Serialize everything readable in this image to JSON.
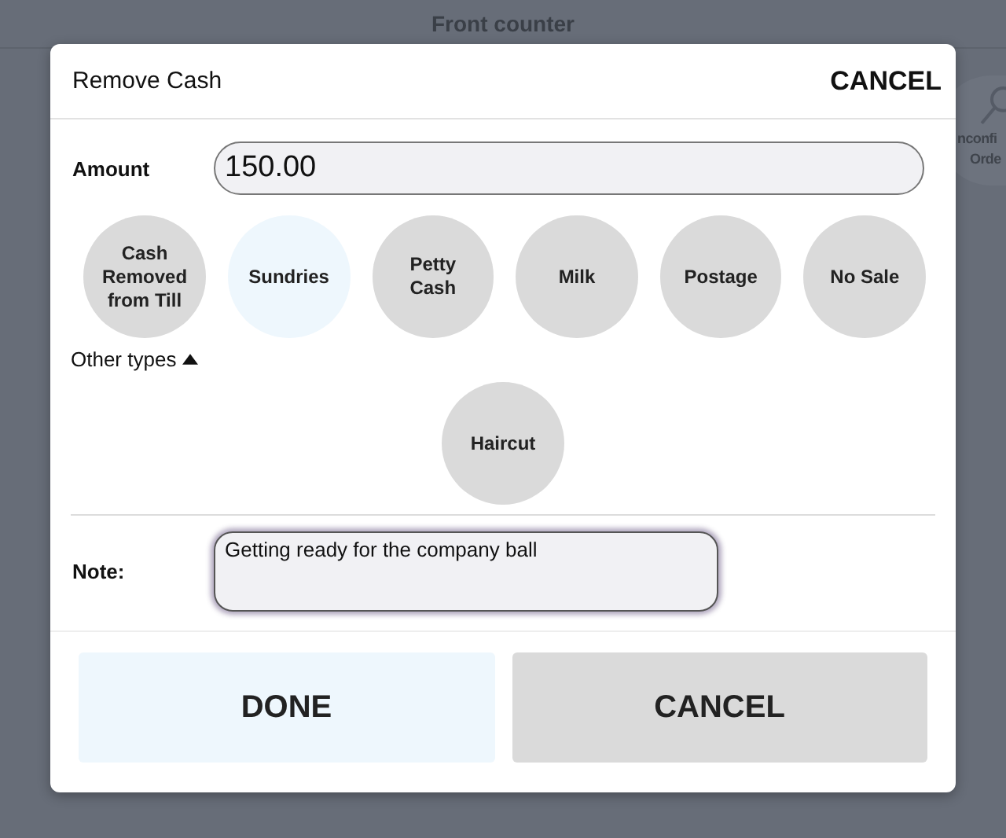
{
  "background": {
    "title": "Front counter",
    "side_button": {
      "lines": [
        "nconfi",
        "Orde"
      ]
    }
  },
  "dialog": {
    "title": "Remove Cash",
    "header_action": "CANCEL",
    "amount": {
      "label": "Amount",
      "value": "150.00"
    },
    "types": [
      {
        "label": "Cash Removed from Till",
        "selected": false
      },
      {
        "label": "Sundries",
        "selected": true
      },
      {
        "label": "Petty Cash",
        "selected": false
      },
      {
        "label": "Milk",
        "selected": false
      },
      {
        "label": "Postage",
        "selected": false
      },
      {
        "label": "No Sale",
        "selected": false
      }
    ],
    "other_types": {
      "label": "Other types",
      "expanded": true,
      "items": [
        {
          "label": "Haircut",
          "selected": false
        }
      ]
    },
    "note": {
      "label": "Note:",
      "value": "Getting ready for the company ball",
      "focused": true
    },
    "buttons": [
      {
        "label": "DONE",
        "kind": "primary"
      },
      {
        "label": "CANCEL",
        "kind": "secondary"
      }
    ]
  }
}
